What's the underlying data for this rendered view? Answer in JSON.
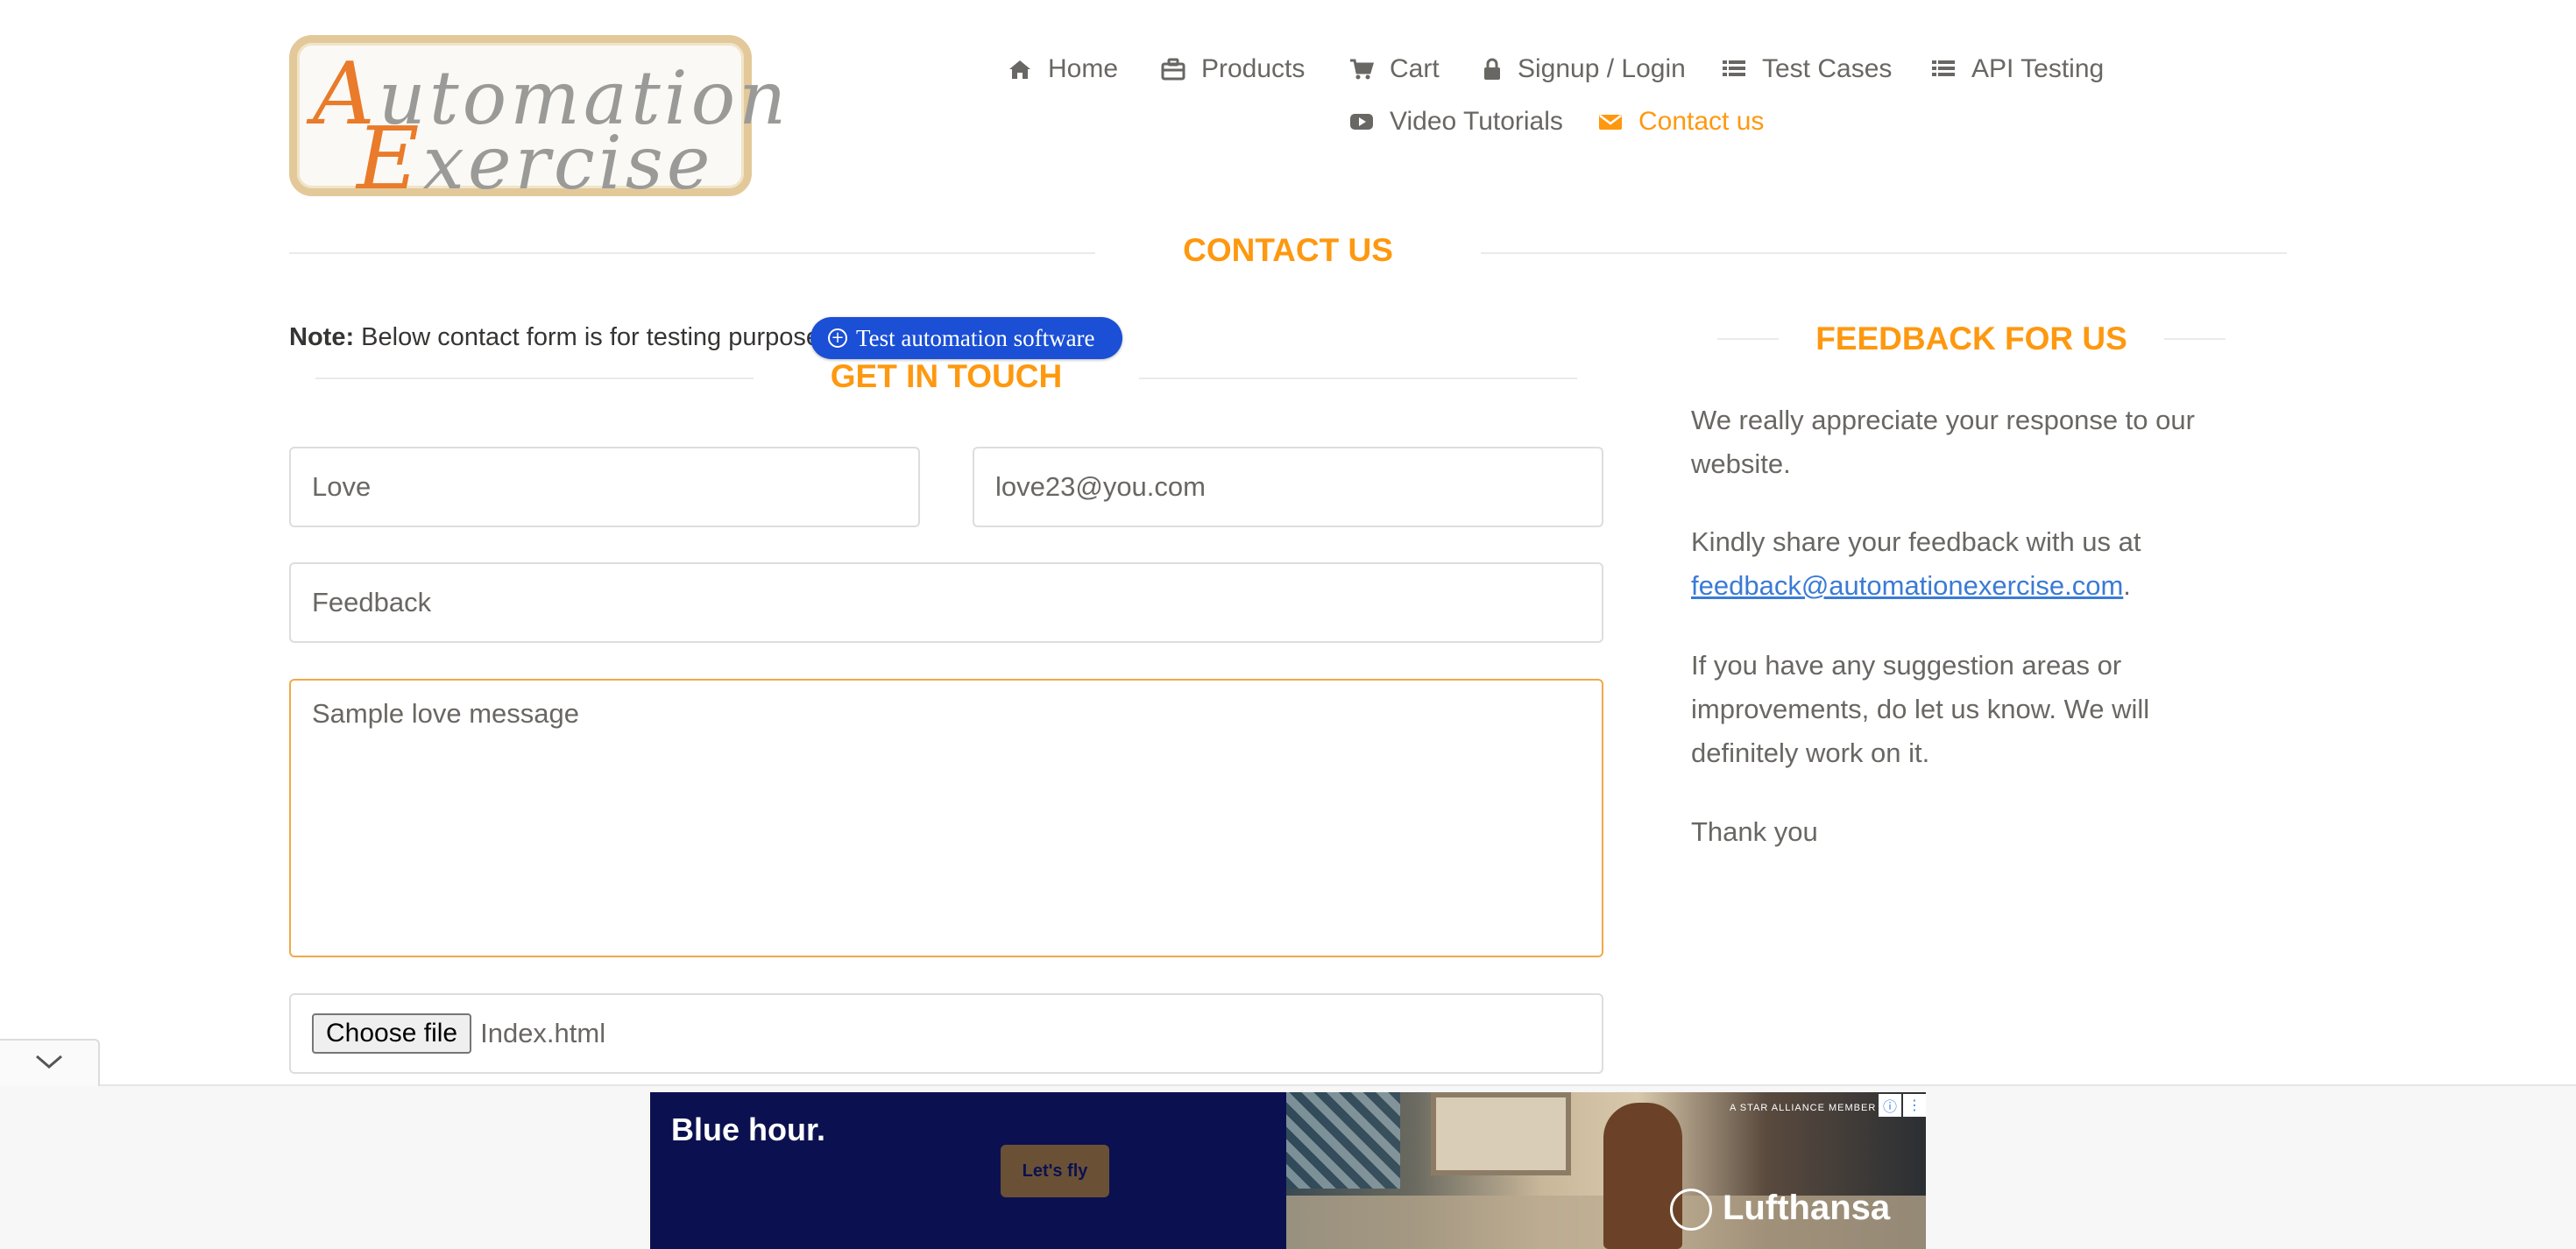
{
  "logo": {
    "line1_cap": "A",
    "line1_rest": "utomation",
    "line2_cap": "E",
    "line2_rest": "xercise"
  },
  "nav": {
    "items": [
      {
        "label": "Home",
        "icon": "home-icon"
      },
      {
        "label": "Products",
        "icon": "briefcase-icon"
      },
      {
        "label": "Cart",
        "icon": "cart-icon"
      },
      {
        "label": "Signup / Login",
        "icon": "lock-icon"
      },
      {
        "label": "Test Cases",
        "icon": "list-icon"
      },
      {
        "label": "API Testing",
        "icon": "list-icon"
      },
      {
        "label": "Video Tutorials",
        "icon": "youtube-icon"
      },
      {
        "label": "Contact us",
        "icon": "envelope-icon",
        "active": true
      }
    ]
  },
  "contact": {
    "title": "CONTACT US",
    "note_label": "Note:",
    "note_text": " Below contact form is for testing purpose.",
    "promo_label": "Test automation software",
    "get_in_touch": "GET IN TOUCH",
    "form": {
      "name_value": "Love",
      "email_value": "love23@you.com",
      "subject_value": "Feedback",
      "message_value": "Sample love message",
      "file_button": "Choose file",
      "file_name": "Index.html"
    }
  },
  "feedback": {
    "title": "FEEDBACK FOR US",
    "para1": "We really appreciate your response to our website.",
    "para2_prefix": "Kindly share your feedback with us at ",
    "para2_link": "feedback@automationexercise.com",
    "para2_suffix": ".",
    "para3": "If you have any suggestion areas or improvements, do let us know. We will definitely work on it.",
    "para4": "Thank you"
  },
  "ad": {
    "headline": "Blue hour.",
    "cta": "Let's fly",
    "brand": "Lufthansa",
    "alliance": "A STAR ALLIANCE MEMBER"
  },
  "colors": {
    "accent": "#fe980f",
    "text": "#696763",
    "link": "#3a7bd5",
    "promo": "#1a4fd6",
    "ad_bg": "#0b1150"
  }
}
